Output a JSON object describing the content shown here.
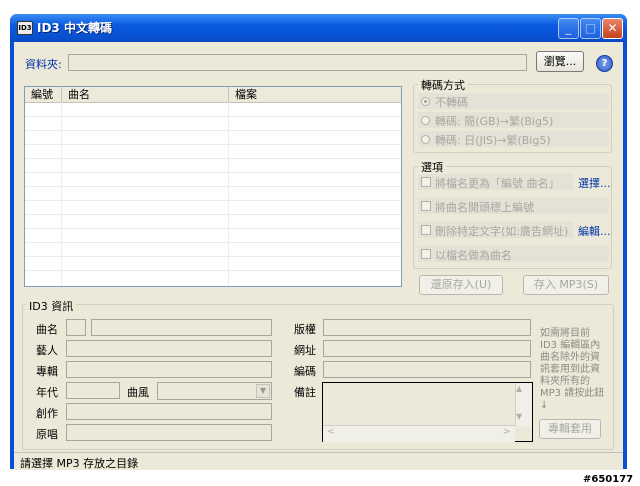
{
  "window": {
    "title": "ID3 中文轉碼",
    "app_icon_text": "ID3"
  },
  "folder": {
    "label": "資料夾:",
    "value": "",
    "browse_label": "瀏覽...",
    "help_label": "?"
  },
  "file_list": {
    "columns": [
      "編號",
      "曲名",
      "檔案"
    ],
    "rows": []
  },
  "conversion": {
    "label": "轉碼方式",
    "options": [
      {
        "label": "不轉碼",
        "selected": true
      },
      {
        "label": "轉碼: 簡(GB)→繁(Big5)",
        "selected": false
      },
      {
        "label": "轉碼: 日(JIS)→繁(Big5)",
        "selected": false
      }
    ]
  },
  "options": {
    "label": "選項",
    "items": [
      {
        "label": "將檔名更為「編號 曲名」",
        "checked": false,
        "link": "選擇..."
      },
      {
        "label": "將曲名開頭標上編號",
        "checked": false,
        "link": ""
      },
      {
        "label": "刪除特定文字(如:廣告網址)",
        "checked": false,
        "link": "編輯..."
      },
      {
        "label": "以檔名做為曲名",
        "checked": false,
        "link": ""
      }
    ]
  },
  "actions": {
    "restore_label": "還原存入(U)",
    "save_mp3_label": "存入 MP3(S)"
  },
  "id3_info": {
    "label": "ID3 資訊",
    "title_label": "曲名",
    "artist_label": "藝人",
    "album_label": "專輯",
    "year_label": "年代",
    "genre_label": "曲風",
    "composer_label": "創作",
    "original_label": "原唱",
    "copyright_label": "版權",
    "url_label": "網址",
    "encoder_label": "編碼",
    "comment_label": "備註",
    "title_value": "",
    "genre_value": "",
    "apply_description": "如需將目前ID3 編輯區內曲名除外的資訊套用到此資料夾所有的 MP3 請按此鈕↓",
    "apply_button_label": "專輯套用"
  },
  "status": {
    "text": "請選擇 MP3 存放之目錄"
  },
  "watermark": "#650177",
  "colors": {
    "titlebar": "#0a5ae0",
    "client_bg": "#ece9d8",
    "link": "#0033aa",
    "disabled_text": "#a8a7a0"
  }
}
